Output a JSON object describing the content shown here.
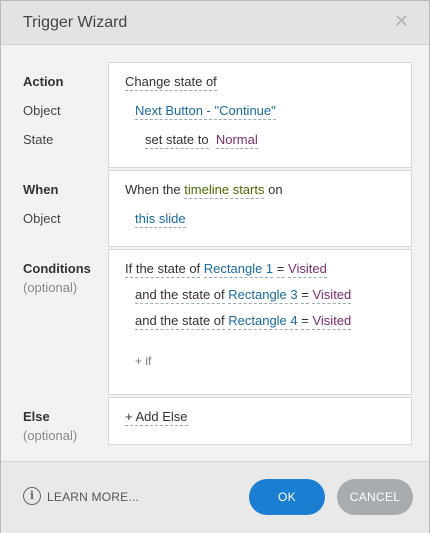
{
  "window": {
    "title": "Trigger Wizard",
    "close_glyph": "✕"
  },
  "action": {
    "labels": {
      "heading": "Action",
      "object": "Object",
      "state": "State"
    },
    "line1": "Change state of",
    "object_value": "Next Button - \"Continue\"",
    "set_state_to": "set state to",
    "state_value": "Normal"
  },
  "when": {
    "labels": {
      "heading": "When",
      "object": "Object"
    },
    "prefix": "When the",
    "event": "timeline starts",
    "suffix": "on",
    "object_value": "this slide"
  },
  "conditions": {
    "labels": {
      "heading": "Conditions",
      "optional": "(optional)"
    },
    "rows": [
      {
        "prefix": "If the state of",
        "object": "Rectangle 1",
        "op": "=",
        "value": "Visited"
      },
      {
        "prefix": "and the state of",
        "object": "Rectangle 3",
        "op": "=",
        "value": "Visited"
      },
      {
        "prefix": "and the state of",
        "object": "Rectangle 4",
        "op": "=",
        "value": "Visited"
      }
    ],
    "add_if": "+ if"
  },
  "else": {
    "labels": {
      "heading": "Else",
      "optional": "(optional)"
    },
    "add_else": "+ Add Else"
  },
  "footer": {
    "help_glyph": "i",
    "learn_more": "LEARN MORE...",
    "ok": "OK",
    "cancel": "CANCEL"
  },
  "colors": {
    "ok_button": "#1a7ed2",
    "cancel_button": "#a7acb1",
    "link_blue": "#1a6ba0",
    "value_purple": "#7b2c6b",
    "event_green": "#4b6b00"
  }
}
